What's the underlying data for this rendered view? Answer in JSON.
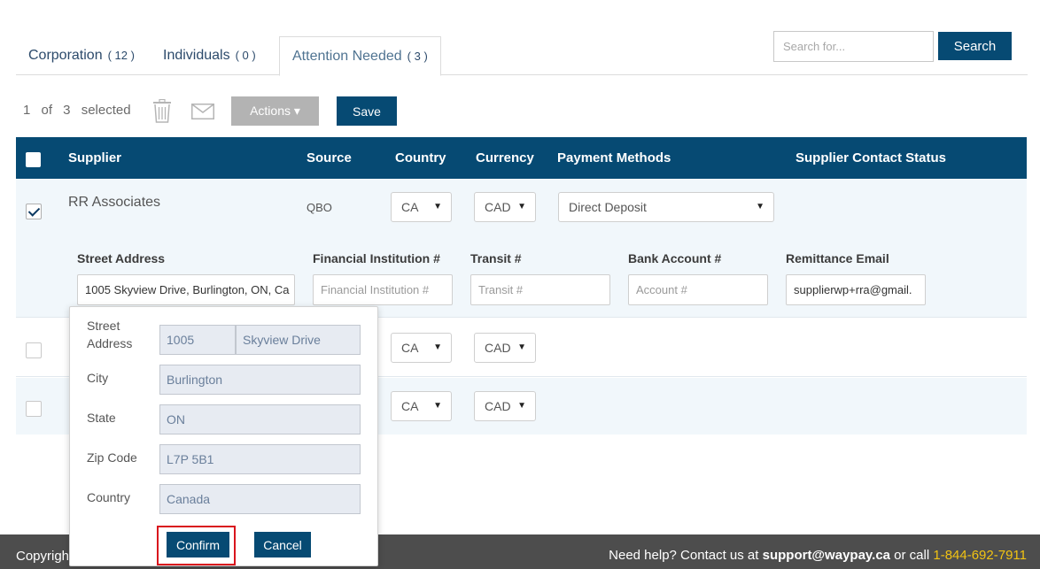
{
  "tabs": [
    {
      "label": "Corporation",
      "count": "( 12 )"
    },
    {
      "label": "Individuals",
      "count": "( 0 )"
    },
    {
      "label": "Attention Needed",
      "count": "( 3 )"
    }
  ],
  "search": {
    "placeholder": "Search for...",
    "button": "Search"
  },
  "toolbar": {
    "selected_text": "1 of 3 selected",
    "actions_label": "Actions ▾",
    "save_label": "Save"
  },
  "table": {
    "headers": [
      "Supplier",
      "Source",
      "Country",
      "Currency",
      "Payment Methods",
      "Supplier Contact Status"
    ],
    "row1": {
      "supplier": "RR Associates",
      "source": "QBO",
      "country": "CA",
      "currency": "CAD",
      "payment_method": "Direct Deposit"
    },
    "row2": {
      "country": "CA",
      "currency": "CAD"
    },
    "row3": {
      "country": "CA",
      "currency": "CAD"
    }
  },
  "details": {
    "street_label": "Street Address",
    "street_value": "1005 Skyview Drive, Burlington, ON, Ca",
    "fi_label": "Financial Institution #",
    "fi_placeholder": "Financial Institution #",
    "transit_label": "Transit #",
    "transit_placeholder": "Transit #",
    "account_label": "Bank Account #",
    "account_placeholder": "Account #",
    "email_label": "Remittance Email",
    "email_value": "supplierwp+rra@gmail."
  },
  "popup": {
    "street_label_1": "Street",
    "street_label_2": "Address",
    "street_number": "1005",
    "street_name": "Skyview Drive",
    "city_label": "City",
    "city": "Burlington",
    "state_label": "State",
    "state": "ON",
    "zip_label": "Zip Code",
    "zip": "L7P 5B1",
    "country_label": "Country",
    "country": "Canada",
    "confirm": "Confirm",
    "cancel": "Cancel"
  },
  "footer": {
    "copyright": "Copyright",
    "help_prefix": "Need help? Contact us at",
    "email": "support@waypay.ca",
    "or_call": "or call",
    "phone": "1-844-692-7911"
  },
  "colors": {
    "primary": "#064a73",
    "row_alt": "#f1f7fb",
    "highlight": "#d9141d",
    "phone": "#f2c312"
  }
}
